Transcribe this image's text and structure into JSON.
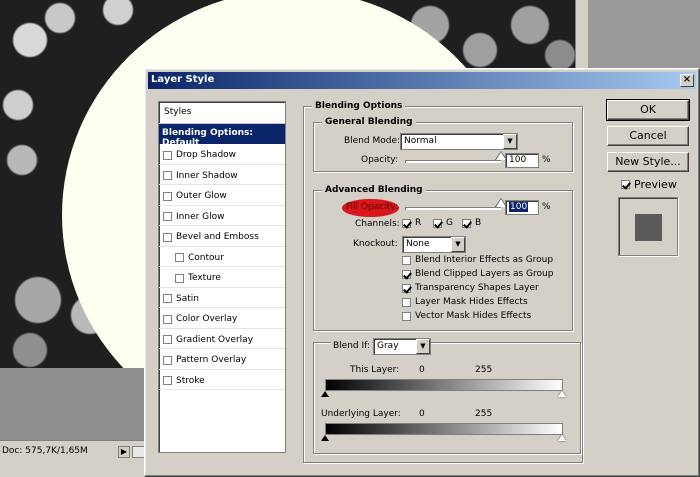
{
  "background": {
    "status_doc": "Doc: 575,7K/1,65M",
    "status_arrow": "▶"
  },
  "dialog": {
    "title": "Layer Style",
    "close_glyph": "×"
  },
  "styles_list": {
    "header": "Styles",
    "selected": "Blending Options: Default",
    "items": [
      {
        "label": "Drop Shadow",
        "checked": false,
        "indent": false
      },
      {
        "label": "Inner Shadow",
        "checked": false,
        "indent": false
      },
      {
        "label": "Outer Glow",
        "checked": false,
        "indent": false
      },
      {
        "label": "Inner Glow",
        "checked": false,
        "indent": false
      },
      {
        "label": "Bevel and Emboss",
        "checked": false,
        "indent": false
      },
      {
        "label": "Contour",
        "checked": false,
        "indent": true
      },
      {
        "label": "Texture",
        "checked": false,
        "indent": true
      },
      {
        "label": "Satin",
        "checked": false,
        "indent": false
      },
      {
        "label": "Color Overlay",
        "checked": false,
        "indent": false
      },
      {
        "label": "Gradient Overlay",
        "checked": false,
        "indent": false
      },
      {
        "label": "Pattern Overlay",
        "checked": false,
        "indent": false
      },
      {
        "label": "Stroke",
        "checked": false,
        "indent": false
      }
    ]
  },
  "blending_options": {
    "title": "Blending Options",
    "general": {
      "title": "General Blending",
      "blend_mode_label": "Blend Mode:",
      "blend_mode_value": "Normal",
      "opacity_label": "Opacity:",
      "opacity_value": "100",
      "opacity_unit": "%",
      "opacity_level": 1.0
    },
    "advanced": {
      "title": "Advanced Blending",
      "fill_opacity_label": "Fill Opacity:",
      "fill_opacity_value": "100",
      "fill_opacity_unit": "%",
      "fill_opacity_level": 1.0,
      "channels_label": "Channels:",
      "channels": [
        {
          "label": "R",
          "checked": true
        },
        {
          "label": "G",
          "checked": true
        },
        {
          "label": "B",
          "checked": true
        }
      ],
      "knockout_label": "Knockout:",
      "knockout_value": "None",
      "options": [
        {
          "label": "Blend Interior Effects as Group",
          "checked": false
        },
        {
          "label": "Blend Clipped Layers as Group",
          "checked": true
        },
        {
          "label": "Transparency Shapes Layer",
          "checked": true
        },
        {
          "label": "Layer Mask Hides Effects",
          "checked": false
        },
        {
          "label": "Vector Mask Hides Effects",
          "checked": false
        }
      ]
    },
    "blend_if": {
      "label": "Blend If:",
      "value": "Gray",
      "this_layer_label": "This Layer:",
      "this_layer_min": "0",
      "this_layer_max": "255",
      "underlying_label": "Underlying Layer:",
      "underlying_min": "0",
      "underlying_max": "255"
    }
  },
  "buttons": {
    "ok": "OK",
    "cancel": "Cancel",
    "new_style": "New Style...",
    "preview_label": "Preview",
    "preview_checked": true
  },
  "colors": {
    "title_start": "#0a246a",
    "title_end": "#a6caf0",
    "selection": "#0a246a",
    "highlight": "#d8161b",
    "preview_swatch": "#5a5a5a"
  }
}
